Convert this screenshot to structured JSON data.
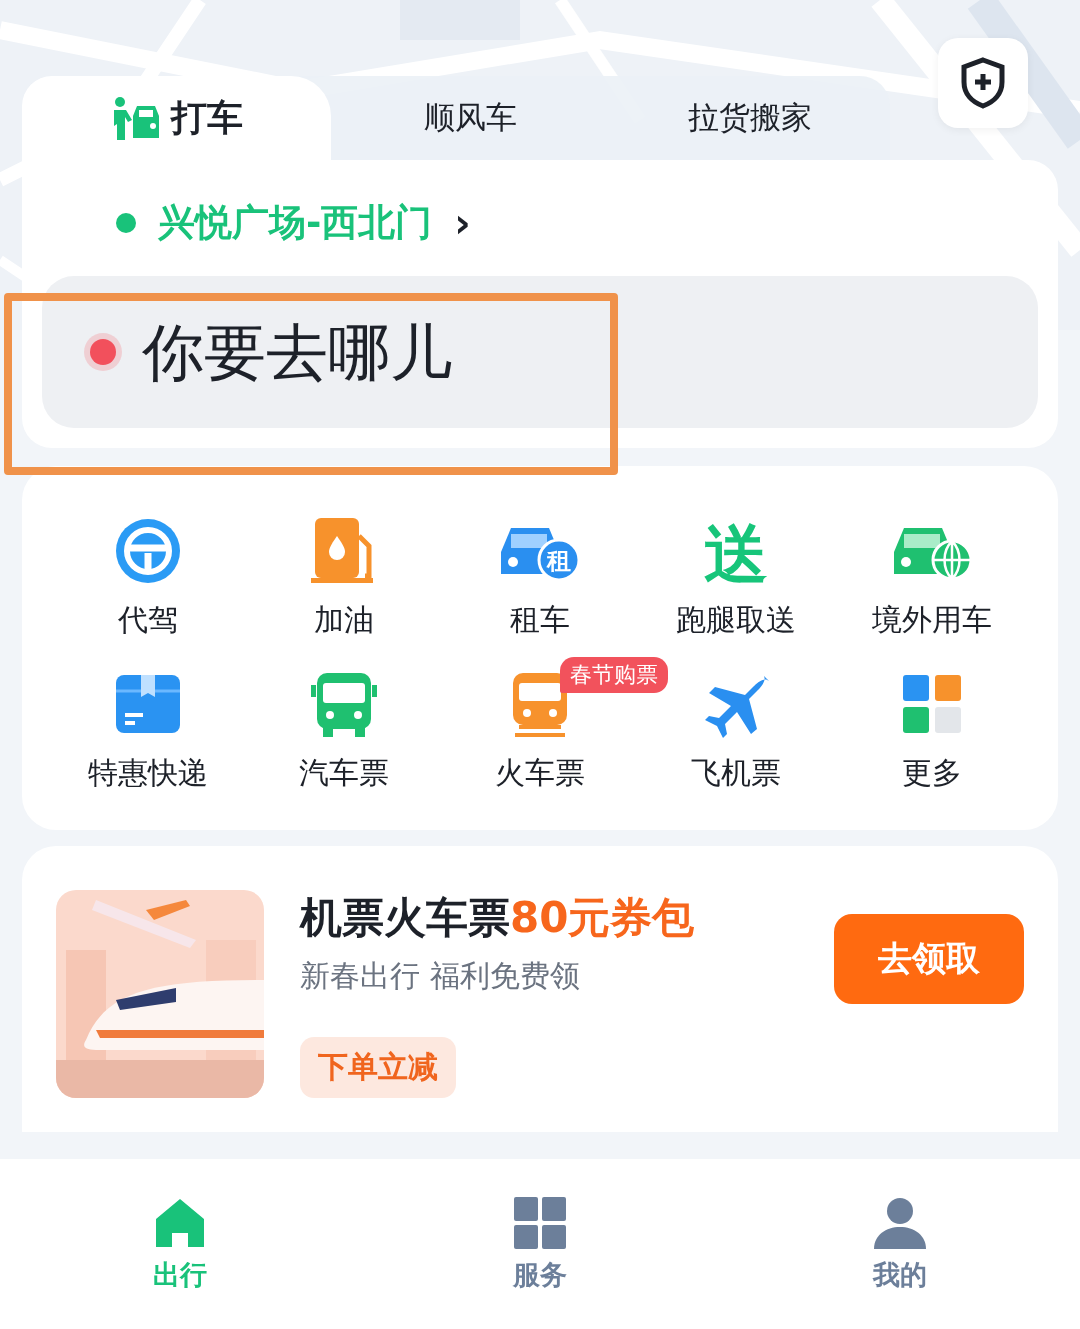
{
  "tabs": [
    {
      "label": "打车",
      "selected": true
    },
    {
      "label": "顺风车",
      "selected": false
    },
    {
      "label": "拉货搬家",
      "selected": false
    }
  ],
  "pickup": {
    "label": "兴悦广场-西北门",
    "arrow": "›"
  },
  "destination": {
    "placeholder": "你要去哪儿"
  },
  "annotation": {
    "kind": "highlight"
  },
  "services": [
    {
      "label": "代驾"
    },
    {
      "label": "加油"
    },
    {
      "label": "租车",
      "glyph": "租"
    },
    {
      "label": "跑腿取送",
      "glyph": "送"
    },
    {
      "label": "境外用车"
    },
    {
      "label": "特惠快递"
    },
    {
      "label": "汽车票"
    },
    {
      "label": "火车票",
      "badge": "春节购票"
    },
    {
      "label": "飞机票"
    },
    {
      "label": "更多"
    }
  ],
  "promo": {
    "title": "机票火车票",
    "title_accent": "80元券包",
    "subtitle": "新春出行 福利免费领",
    "tag": "下单立减",
    "button": "去领取"
  },
  "nav": [
    {
      "label": "出行",
      "selected": true
    },
    {
      "label": "服务",
      "selected": false
    },
    {
      "label": "我的",
      "selected": false
    }
  ]
}
